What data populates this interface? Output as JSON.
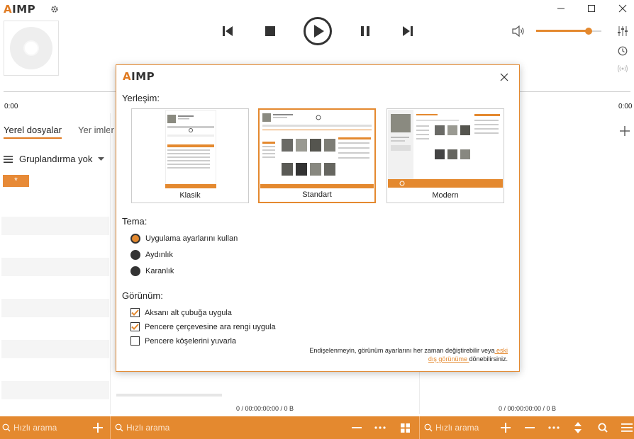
{
  "app": {
    "logo_text": "IMP",
    "logo_accent": "A"
  },
  "player": {
    "time_left": "0:00",
    "time_right": "0:00"
  },
  "tabs": [
    {
      "label": "Yerel dosyalar"
    },
    {
      "label": "Yer imler"
    }
  ],
  "grouping": {
    "label": "Gruplandırma yok"
  },
  "filter_tag": "*",
  "status": {
    "left": "0 / 00:00:00:00 / 0 B",
    "right": "0 / 00:00:00:00 / 0 B"
  },
  "bottombar": {
    "search_left_placeholder": "Hızlı arama",
    "search_mid_placeholder": "Hızlı arama",
    "search_right_placeholder": "Hızlı arama"
  },
  "dialog": {
    "logo_text": "IMP",
    "logo_accent": "A",
    "layout_heading": "Yerleşim:",
    "layouts": [
      {
        "label": "Klasik",
        "selected": false
      },
      {
        "label": "Standart",
        "selected": true
      },
      {
        "label": "Modern",
        "selected": false
      }
    ],
    "theme_heading": "Tema:",
    "themes": [
      {
        "label": "Uygulama ayarlarını kullan",
        "selected": true
      },
      {
        "label": "Aydınlık",
        "selected": false
      },
      {
        "label": "Karanlık",
        "selected": false
      }
    ],
    "view_heading": "Görünüm:",
    "options": [
      {
        "label": "Aksanı alt çubuğa uygula",
        "checked": true
      },
      {
        "label": "Pencere çerçevesine ara rengi uygula",
        "checked": true
      },
      {
        "label": "Pencere köşelerini yuvarla",
        "checked": false
      }
    ],
    "note_text": "Endişelenmeyin, görünüm ayarlarını her zaman değiştirebilir veya",
    "note_link": " eski dış görünüme ",
    "note_tail": "dönebilirsiniz."
  },
  "colors": {
    "accent": "#e4892f",
    "accent_light": "#e78a37"
  },
  "volume": {
    "level": 0.8
  },
  "icons": [
    "settings-gear-icon",
    "minimize-icon",
    "maximize-icon",
    "close-icon",
    "previous-icon",
    "stop-icon",
    "play-icon",
    "pause-icon",
    "next-icon",
    "volume-icon",
    "equalizer-icon",
    "clock-icon",
    "radio-icon",
    "add-icon",
    "menu-icon",
    "chevron-down-icon",
    "search-icon",
    "minus-icon",
    "more-icon",
    "grid-icon",
    "sort-icon",
    "hamburger-icon"
  ]
}
